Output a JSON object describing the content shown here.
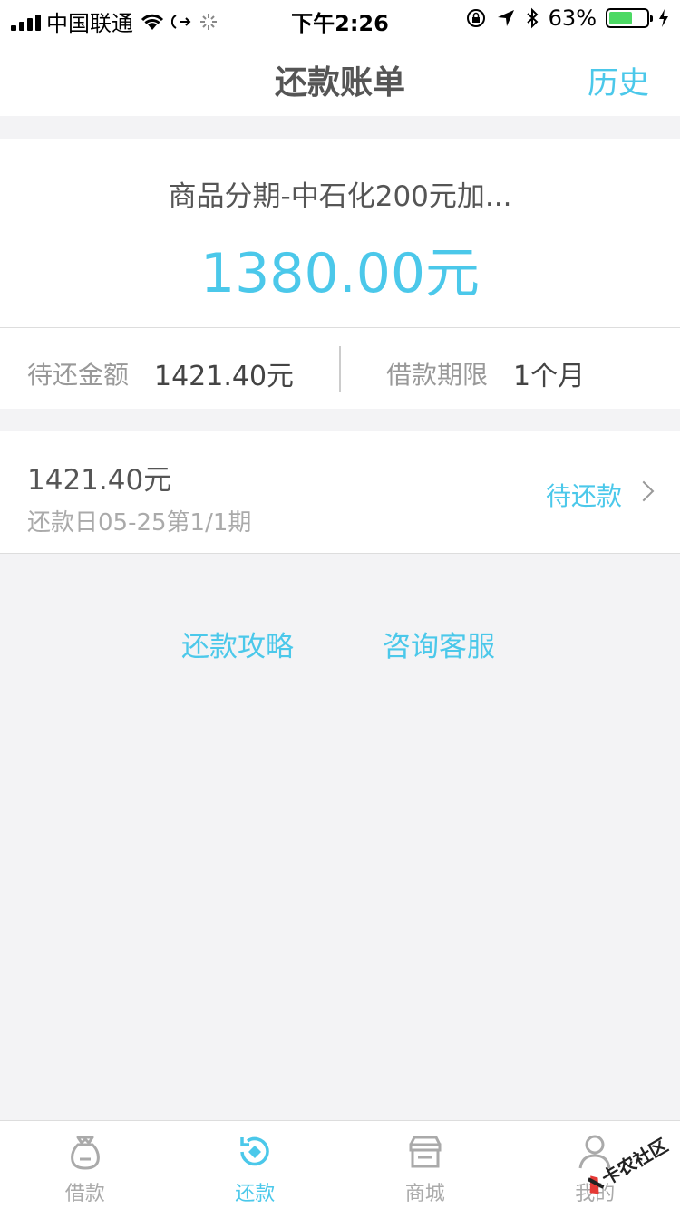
{
  "status_bar": {
    "carrier": "中国联通",
    "time": "下午2:26",
    "battery_percent": "63%"
  },
  "nav": {
    "title": "还款账单",
    "history": "历史"
  },
  "summary": {
    "product_name": "商品分期-中石化200元加...",
    "amount": "1380.00元",
    "pending_label": "待还金额",
    "pending_value": "1421.40元",
    "term_label": "借款期限",
    "term_value": "1个月"
  },
  "bill": {
    "amount": "1421.40元",
    "due": "还款日05-25第1/1期",
    "status": "待还款"
  },
  "links": {
    "guide": "还款攻略",
    "service": "咨询客服"
  },
  "tabs": [
    {
      "label": "借款",
      "icon": "bag-icon"
    },
    {
      "label": "还款",
      "icon": "repay-icon"
    },
    {
      "label": "商城",
      "icon": "store-icon"
    },
    {
      "label": "我的",
      "icon": "person-icon"
    }
  ],
  "watermark": "卡农社区",
  "colors": {
    "accent": "#4bc8ea",
    "background": "#f3f3f5"
  }
}
